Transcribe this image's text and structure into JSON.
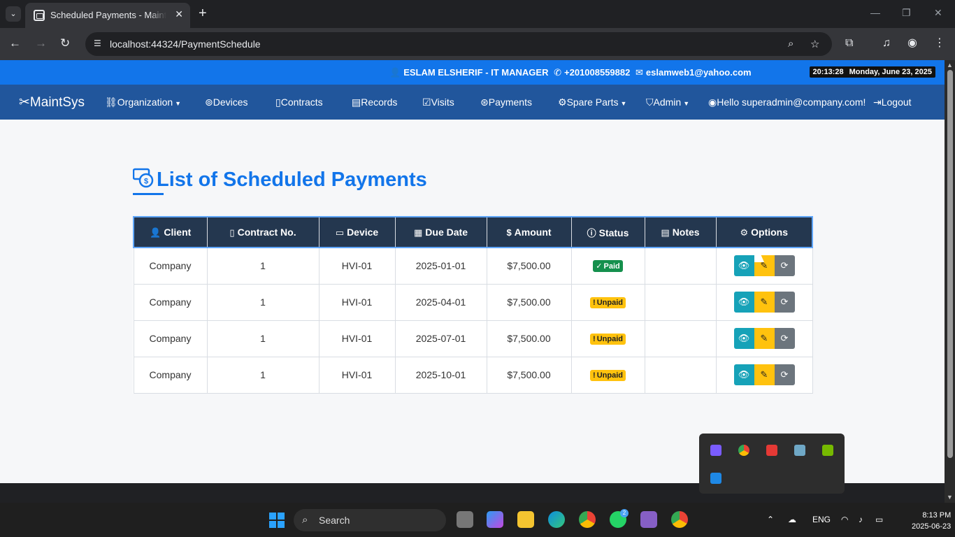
{
  "browser": {
    "tab_title": "Scheduled Payments - MaintManager",
    "url": "localhost:44324/PaymentSchedule",
    "new_tab": "+",
    "close": "✕"
  },
  "topbar": {
    "contact_name": "ESLAM ELSHERIF - IT MANAGER",
    "phone": "+201008559882",
    "email": "eslamweb1@yahoo.com",
    "time": "20:13:28",
    "date": "Monday, June 23, 2025"
  },
  "navbar": {
    "brand": "MaintSys",
    "items": [
      {
        "label": "Organization",
        "dropdown": true
      },
      {
        "label": "Devices"
      },
      {
        "label": "Contracts"
      },
      {
        "label": "Records"
      },
      {
        "label": "Visits"
      },
      {
        "label": "Payments"
      },
      {
        "label": "Spare Parts",
        "dropdown": true
      },
      {
        "label": "Admin",
        "dropdown": true
      }
    ],
    "greeting": "Hello superadmin@company.com!",
    "logout": "Logout"
  },
  "page": {
    "title": "List of Scheduled Payments"
  },
  "table": {
    "headers": [
      "Client",
      "Contract No.",
      "Device",
      "Due Date",
      "Amount",
      "Status",
      "Notes",
      "Options"
    ],
    "rows": [
      {
        "client": "Company",
        "contract": "1",
        "device": "HVI-01",
        "due": "2025-01-01",
        "amount": "$7,500.00",
        "status": "Paid",
        "notes": ""
      },
      {
        "client": "Company",
        "contract": "1",
        "device": "HVI-01",
        "due": "2025-04-01",
        "amount": "$7,500.00",
        "status": "Unpaid",
        "notes": ""
      },
      {
        "client": "Company",
        "contract": "1",
        "device": "HVI-01",
        "due": "2025-07-01",
        "amount": "$7,500.00",
        "status": "Unpaid",
        "notes": ""
      },
      {
        "client": "Company",
        "contract": "1",
        "device": "HVI-01",
        "due": "2025-10-01",
        "amount": "$7,500.00",
        "status": "Unpaid",
        "notes": ""
      }
    ]
  },
  "taskbar": {
    "search": "Search",
    "whatsapp_badge": "2",
    "lang": "ENG",
    "time": "8:13 PM",
    "date": "2025-06-23"
  },
  "colors": {
    "accent": "#1275ea",
    "navbar": "#21569c",
    "header_bg": "#24374f",
    "paid": "#15904d",
    "unpaid": "#ffc20e",
    "view": "#16a2b8",
    "sync": "#6c757d"
  }
}
